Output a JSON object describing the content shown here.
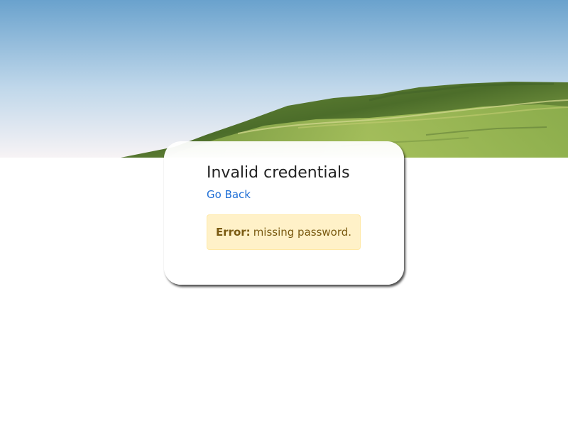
{
  "page": {
    "title": "Invalid credentials",
    "back_link": "Go Back"
  },
  "alert": {
    "label": "Error:",
    "message": "missing password."
  },
  "hero": {
    "image_name": "green-hills-landscape",
    "sky_top": "#6aa2cd",
    "sky_bottom": "#f7f3f5",
    "hill_dark": "#53772d",
    "hill_light": "#9cb856"
  }
}
